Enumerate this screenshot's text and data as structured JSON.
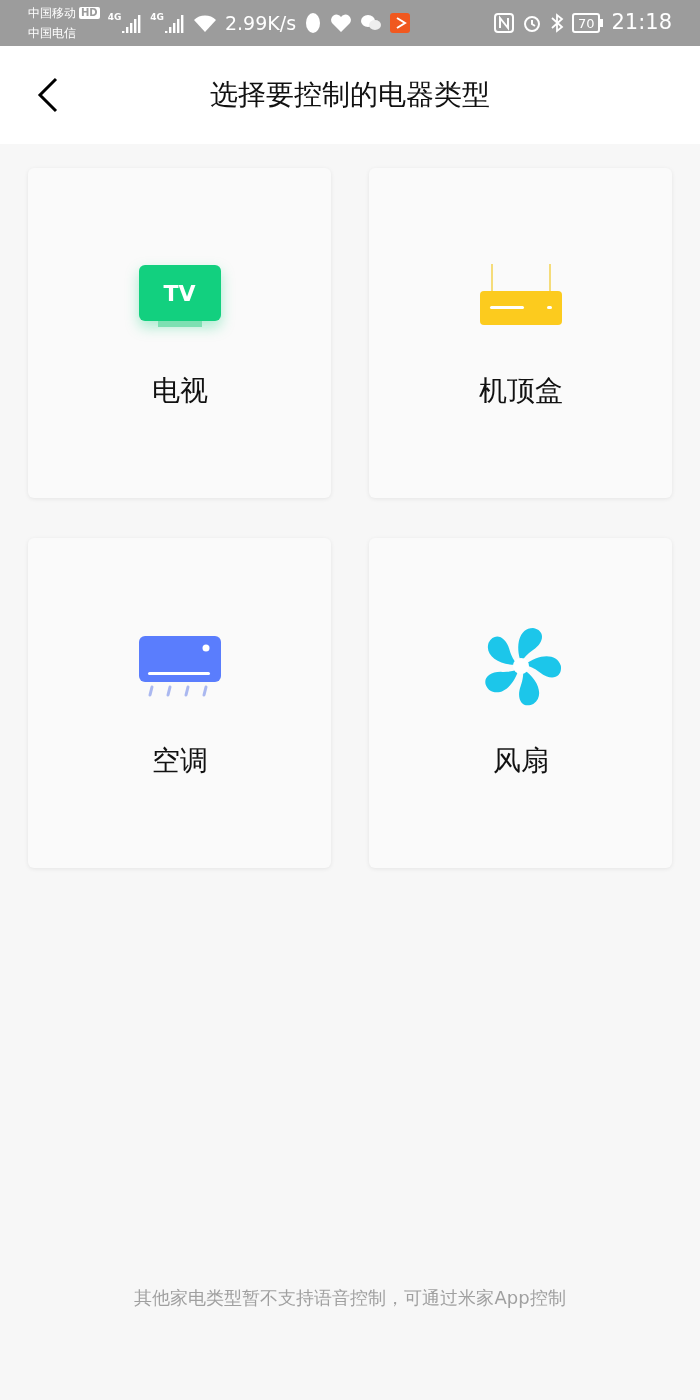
{
  "status_bar": {
    "carrier_1": "中国移动",
    "hd_badge": "HD",
    "carrier_2": "中国电信",
    "network_1": "4G",
    "network_2": "4G",
    "speed": "2.99K/s",
    "battery": "70",
    "time": "21:18"
  },
  "header": {
    "title": "选择要控制的电器类型"
  },
  "devices": [
    {
      "kind": "tv",
      "label": "电视",
      "icon_text": "TV"
    },
    {
      "kind": "settop",
      "label": "机顶盒"
    },
    {
      "kind": "ac",
      "label": "空调"
    },
    {
      "kind": "fan",
      "label": "风扇"
    }
  ],
  "footer": {
    "note": "其他家电类型暂不支持语音控制，可通过米家App控制"
  }
}
